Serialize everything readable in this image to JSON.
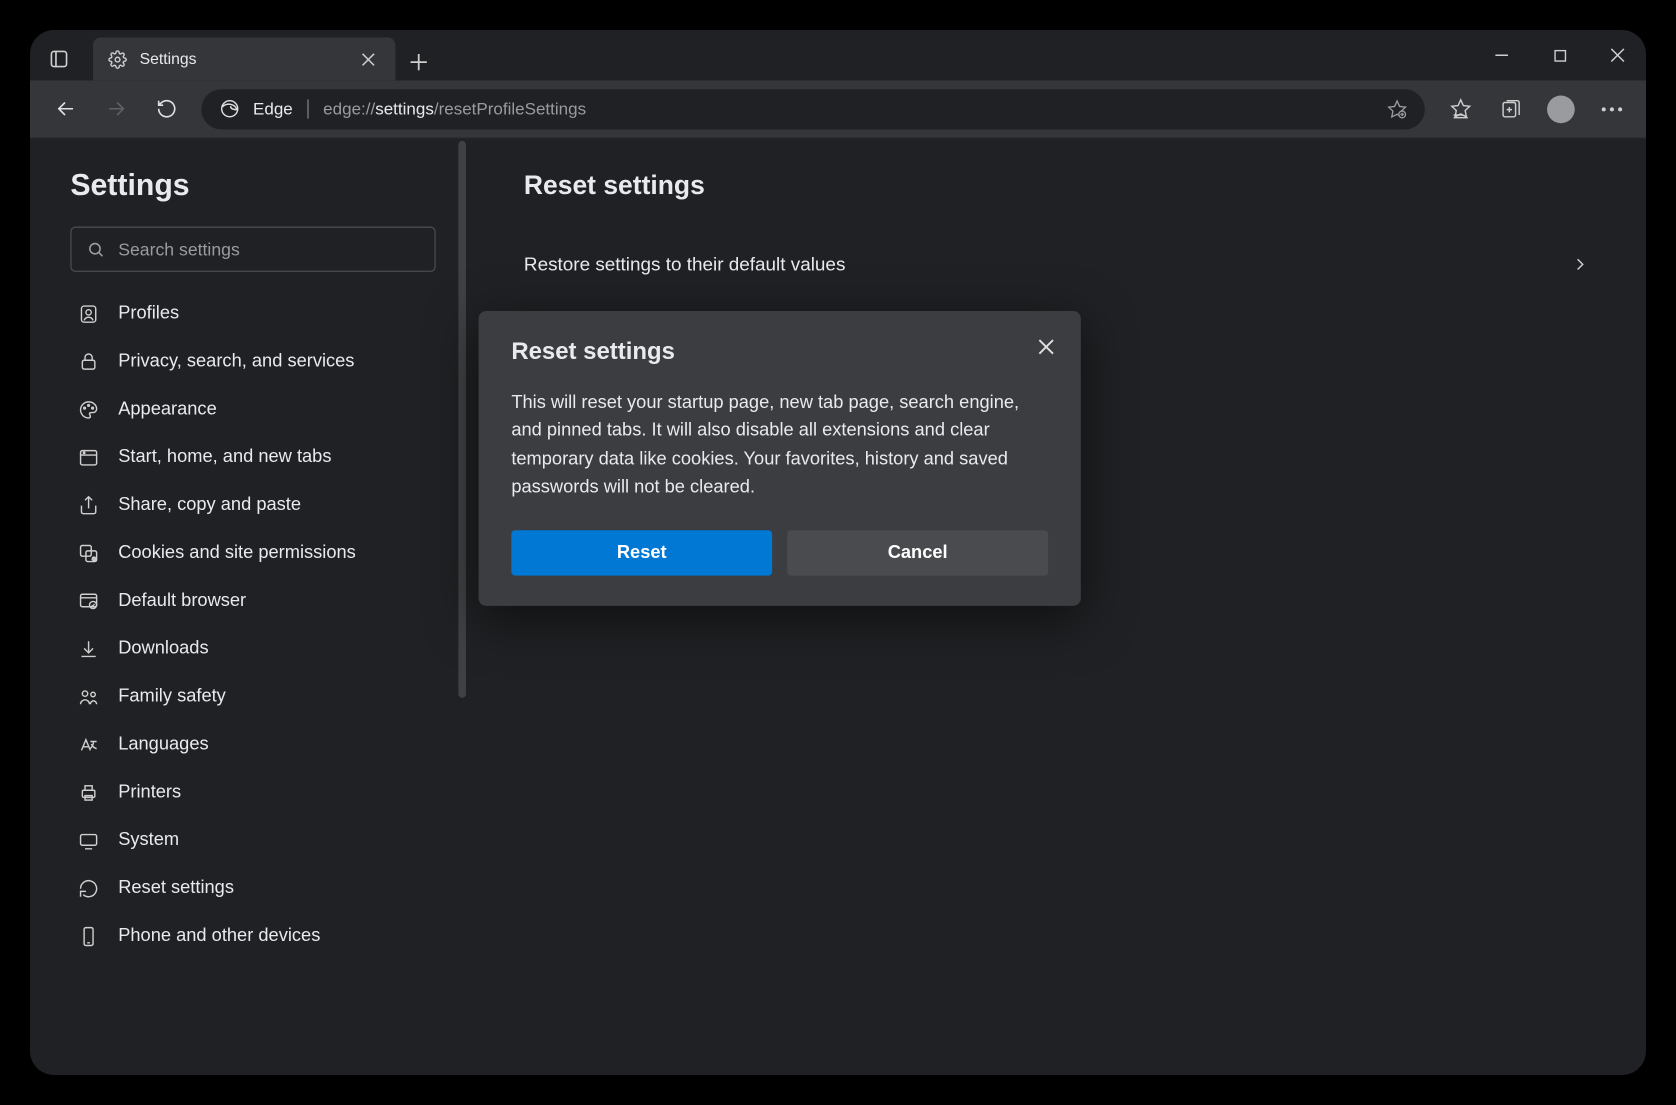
{
  "tab": {
    "title": "Settings"
  },
  "addr": {
    "product": "Edge",
    "scheme": "edge://",
    "path_bold": "settings",
    "path_rest": "/resetProfileSettings"
  },
  "sidebar": {
    "heading": "Settings",
    "search_placeholder": "Search settings",
    "items": [
      {
        "label": "Profiles"
      },
      {
        "label": "Privacy, search, and services"
      },
      {
        "label": "Appearance"
      },
      {
        "label": "Start, home, and new tabs"
      },
      {
        "label": "Share, copy and paste"
      },
      {
        "label": "Cookies and site permissions"
      },
      {
        "label": "Default browser"
      },
      {
        "label": "Downloads"
      },
      {
        "label": "Family safety"
      },
      {
        "label": "Languages"
      },
      {
        "label": "Printers"
      },
      {
        "label": "System"
      },
      {
        "label": "Reset settings"
      },
      {
        "label": "Phone and other devices"
      }
    ]
  },
  "main": {
    "heading": "Reset settings",
    "row_label": "Restore settings to their default values"
  },
  "dialog": {
    "title": "Reset settings",
    "body": "This will reset your startup page, new tab page, search engine, and pinned tabs. It will also disable all extensions and clear temporary data like cookies. Your favorites, history and saved passwords will not be cleared.",
    "primary": "Reset",
    "secondary": "Cancel"
  }
}
